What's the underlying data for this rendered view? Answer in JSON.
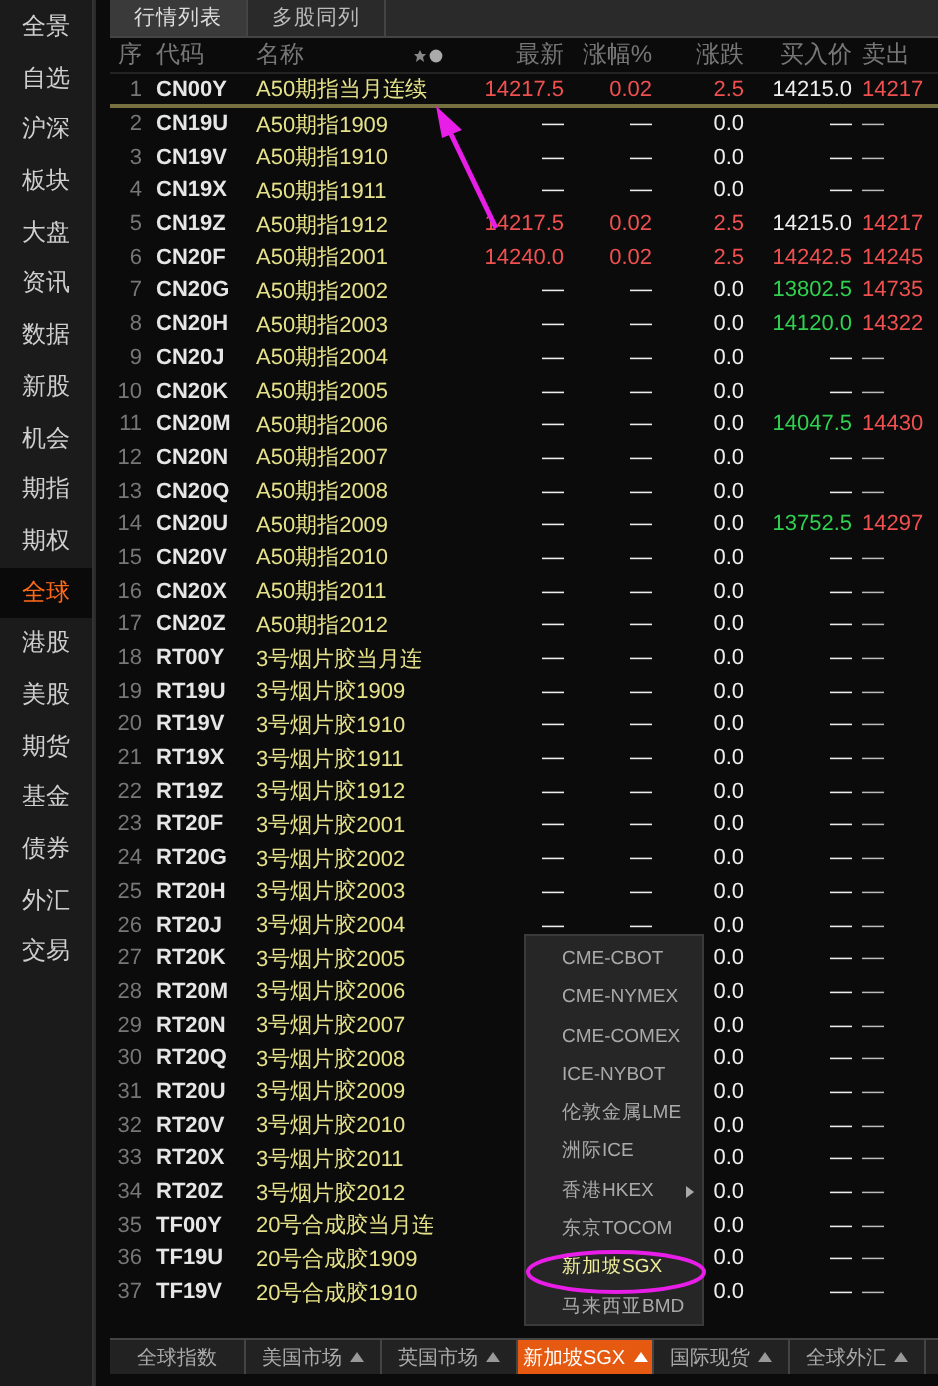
{
  "sidebar": {
    "items": [
      {
        "label": "全景",
        "selected": false
      },
      {
        "label": "自选",
        "selected": false
      },
      {
        "label": "沪深",
        "selected": false
      },
      {
        "label": "板块",
        "selected": false
      },
      {
        "label": "大盘",
        "selected": false
      },
      {
        "label": "资讯",
        "selected": false
      },
      {
        "label": "数据",
        "selected": false
      },
      {
        "label": "新股",
        "selected": false
      },
      {
        "label": "机会",
        "selected": false
      },
      {
        "label": "期指",
        "selected": false
      },
      {
        "label": "期权",
        "selected": false
      },
      {
        "label": "全球",
        "selected": true
      },
      {
        "label": "港股",
        "selected": false
      },
      {
        "label": "美股",
        "selected": false
      },
      {
        "label": "期货",
        "selected": false
      },
      {
        "label": "基金",
        "selected": false
      },
      {
        "label": "债券",
        "selected": false
      },
      {
        "label": "外汇",
        "selected": false
      },
      {
        "label": "交易",
        "selected": false
      }
    ]
  },
  "tabs": [
    {
      "label": "行情列表",
      "selected": true
    },
    {
      "label": "多股同列",
      "selected": false
    }
  ],
  "table": {
    "columns": [
      "序",
      "代码",
      "名称",
      "最新",
      "涨幅%",
      "涨跌",
      "买入价",
      "卖出"
    ],
    "rows": [
      {
        "no": "1",
        "code": "CN00Y",
        "name": "A50期指当月连续",
        "last": "14217.5",
        "pct": "0.02",
        "chg": "2.5",
        "color": "#f05050",
        "bid": {
          "value": "14215.0",
          "color": "#eeeeee"
        },
        "ask": "14217",
        "selected": true
      },
      {
        "no": "2",
        "code": "CN19U",
        "name": "A50期指1909",
        "last": "—",
        "pct": "—",
        "chg": "0.0",
        "color": "#eeeeee",
        "bid": {
          "value": "—",
          "color": "#eeeeee"
        },
        "ask": "—",
        "selected": false
      },
      {
        "no": "3",
        "code": "CN19V",
        "name": "A50期指1910",
        "last": "—",
        "pct": "—",
        "chg": "0.0",
        "color": "#eeeeee",
        "bid": {
          "value": "—",
          "color": "#eeeeee"
        },
        "ask": "—",
        "selected": false
      },
      {
        "no": "4",
        "code": "CN19X",
        "name": "A50期指1911",
        "last": "—",
        "pct": "—",
        "chg": "0.0",
        "color": "#eeeeee",
        "bid": {
          "value": "—",
          "color": "#eeeeee"
        },
        "ask": "—",
        "selected": false
      },
      {
        "no": "5",
        "code": "CN19Z",
        "name": "A50期指1912",
        "last": "14217.5",
        "pct": "0.02",
        "chg": "2.5",
        "color": "#f05050",
        "bid": {
          "value": "14215.0",
          "color": "#eeeeee"
        },
        "ask": "14217",
        "selected": false
      },
      {
        "no": "6",
        "code": "CN20F",
        "name": "A50期指2001",
        "last": "14240.0",
        "pct": "0.02",
        "chg": "2.5",
        "color": "#f05050",
        "bid": {
          "value": "14242.5",
          "color": "#f05050"
        },
        "ask": "14245",
        "selected": false
      },
      {
        "no": "7",
        "code": "CN20G",
        "name": "A50期指2002",
        "last": "—",
        "pct": "—",
        "chg": "0.0",
        "color": "#eeeeee",
        "bid": {
          "value": "13802.5",
          "color": "#30d050"
        },
        "ask": "14735",
        "selected": false
      },
      {
        "no": "8",
        "code": "CN20H",
        "name": "A50期指2003",
        "last": "—",
        "pct": "—",
        "chg": "0.0",
        "color": "#eeeeee",
        "bid": {
          "value": "14120.0",
          "color": "#30d050"
        },
        "ask": "14322",
        "selected": false
      },
      {
        "no": "9",
        "code": "CN20J",
        "name": "A50期指2004",
        "last": "—",
        "pct": "—",
        "chg": "0.0",
        "color": "#eeeeee",
        "bid": {
          "value": "—",
          "color": "#eeeeee"
        },
        "ask": "—",
        "selected": false
      },
      {
        "no": "10",
        "code": "CN20K",
        "name": "A50期指2005",
        "last": "—",
        "pct": "—",
        "chg": "0.0",
        "color": "#eeeeee",
        "bid": {
          "value": "—",
          "color": "#eeeeee"
        },
        "ask": "—",
        "selected": false
      },
      {
        "no": "11",
        "code": "CN20M",
        "name": "A50期指2006",
        "last": "—",
        "pct": "—",
        "chg": "0.0",
        "color": "#eeeeee",
        "bid": {
          "value": "14047.5",
          "color": "#30d050"
        },
        "ask": "14430",
        "selected": false
      },
      {
        "no": "12",
        "code": "CN20N",
        "name": "A50期指2007",
        "last": "—",
        "pct": "—",
        "chg": "0.0",
        "color": "#eeeeee",
        "bid": {
          "value": "—",
          "color": "#eeeeee"
        },
        "ask": "—",
        "selected": false
      },
      {
        "no": "13",
        "code": "CN20Q",
        "name": "A50期指2008",
        "last": "—",
        "pct": "—",
        "chg": "0.0",
        "color": "#eeeeee",
        "bid": {
          "value": "—",
          "color": "#eeeeee"
        },
        "ask": "—",
        "selected": false
      },
      {
        "no": "14",
        "code": "CN20U",
        "name": "A50期指2009",
        "last": "—",
        "pct": "—",
        "chg": "0.0",
        "color": "#eeeeee",
        "bid": {
          "value": "13752.5",
          "color": "#30d050"
        },
        "ask": "14297",
        "selected": false
      },
      {
        "no": "15",
        "code": "CN20V",
        "name": "A50期指2010",
        "last": "—",
        "pct": "—",
        "chg": "0.0",
        "color": "#eeeeee",
        "bid": {
          "value": "—",
          "color": "#eeeeee"
        },
        "ask": "—",
        "selected": false
      },
      {
        "no": "16",
        "code": "CN20X",
        "name": "A50期指2011",
        "last": "—",
        "pct": "—",
        "chg": "0.0",
        "color": "#eeeeee",
        "bid": {
          "value": "—",
          "color": "#eeeeee"
        },
        "ask": "—",
        "selected": false
      },
      {
        "no": "17",
        "code": "CN20Z",
        "name": "A50期指2012",
        "last": "—",
        "pct": "—",
        "chg": "0.0",
        "color": "#eeeeee",
        "bid": {
          "value": "—",
          "color": "#eeeeee"
        },
        "ask": "—",
        "selected": false
      },
      {
        "no": "18",
        "code": "RT00Y",
        "name": "3号烟片胶当月连",
        "last": "—",
        "pct": "—",
        "chg": "0.0",
        "color": "#eeeeee",
        "bid": {
          "value": "—",
          "color": "#eeeeee"
        },
        "ask": "—",
        "selected": false
      },
      {
        "no": "19",
        "code": "RT19U",
        "name": "3号烟片胶1909",
        "last": "—",
        "pct": "—",
        "chg": "0.0",
        "color": "#eeeeee",
        "bid": {
          "value": "—",
          "color": "#eeeeee"
        },
        "ask": "—",
        "selected": false
      },
      {
        "no": "20",
        "code": "RT19V",
        "name": "3号烟片胶1910",
        "last": "—",
        "pct": "—",
        "chg": "0.0",
        "color": "#eeeeee",
        "bid": {
          "value": "—",
          "color": "#eeeeee"
        },
        "ask": "—",
        "selected": false
      },
      {
        "no": "21",
        "code": "RT19X",
        "name": "3号烟片胶1911",
        "last": "—",
        "pct": "—",
        "chg": "0.0",
        "color": "#eeeeee",
        "bid": {
          "value": "—",
          "color": "#eeeeee"
        },
        "ask": "—",
        "selected": false
      },
      {
        "no": "22",
        "code": "RT19Z",
        "name": "3号烟片胶1912",
        "last": "—",
        "pct": "—",
        "chg": "0.0",
        "color": "#eeeeee",
        "bid": {
          "value": "—",
          "color": "#eeeeee"
        },
        "ask": "—",
        "selected": false
      },
      {
        "no": "23",
        "code": "RT20F",
        "name": "3号烟片胶2001",
        "last": "—",
        "pct": "—",
        "chg": "0.0",
        "color": "#eeeeee",
        "bid": {
          "value": "—",
          "color": "#eeeeee"
        },
        "ask": "—",
        "selected": false
      },
      {
        "no": "24",
        "code": "RT20G",
        "name": "3号烟片胶2002",
        "last": "—",
        "pct": "—",
        "chg": "0.0",
        "color": "#eeeeee",
        "bid": {
          "value": "—",
          "color": "#eeeeee"
        },
        "ask": "—",
        "selected": false
      },
      {
        "no": "25",
        "code": "RT20H",
        "name": "3号烟片胶2003",
        "last": "—",
        "pct": "—",
        "chg": "0.0",
        "color": "#eeeeee",
        "bid": {
          "value": "—",
          "color": "#eeeeee"
        },
        "ask": "—",
        "selected": false
      },
      {
        "no": "26",
        "code": "RT20J",
        "name": "3号烟片胶2004",
        "last": "—",
        "pct": "—",
        "chg": "0.0",
        "color": "#eeeeee",
        "bid": {
          "value": "—",
          "color": "#eeeeee"
        },
        "ask": "—",
        "selected": false
      },
      {
        "no": "27",
        "code": "RT20K",
        "name": "3号烟片胶2005",
        "chg": "0.0",
        "color": "#eeeeee",
        "bid": {
          "value": "—",
          "color": "#eeeeee"
        },
        "ask": "—",
        "selected": false
      },
      {
        "no": "28",
        "code": "RT20M",
        "name": "3号烟片胶2006",
        "chg": "0.0",
        "color": "#eeeeee",
        "bid": {
          "value": "—",
          "color": "#eeeeee"
        },
        "ask": "—",
        "selected": false
      },
      {
        "no": "29",
        "code": "RT20N",
        "name": "3号烟片胶2007",
        "chg": "0.0",
        "color": "#eeeeee",
        "bid": {
          "value": "—",
          "color": "#eeeeee"
        },
        "ask": "—",
        "selected": false
      },
      {
        "no": "30",
        "code": "RT20Q",
        "name": "3号烟片胶2008",
        "chg": "0.0",
        "color": "#eeeeee",
        "bid": {
          "value": "—",
          "color": "#eeeeee"
        },
        "ask": "—",
        "selected": false
      },
      {
        "no": "31",
        "code": "RT20U",
        "name": "3号烟片胶2009",
        "chg": "0.0",
        "color": "#eeeeee",
        "bid": {
          "value": "—",
          "color": "#eeeeee"
        },
        "ask": "—",
        "selected": false
      },
      {
        "no": "32",
        "code": "RT20V",
        "name": "3号烟片胶2010",
        "chg": "0.0",
        "color": "#eeeeee",
        "bid": {
          "value": "—",
          "color": "#eeeeee"
        },
        "ask": "—",
        "selected": false
      },
      {
        "no": "33",
        "code": "RT20X",
        "name": "3号烟片胶2011",
        "chg": "0.0",
        "color": "#eeeeee",
        "bid": {
          "value": "—",
          "color": "#eeeeee"
        },
        "ask": "—",
        "selected": false
      },
      {
        "no": "34",
        "code": "RT20Z",
        "name": "3号烟片胶2012",
        "chg": "0.0",
        "color": "#eeeeee",
        "bid": {
          "value": "—",
          "color": "#eeeeee"
        },
        "ask": "—",
        "selected": false
      },
      {
        "no": "35",
        "code": "TF00Y",
        "name": "20号合成胶当月连",
        "chg": "0.0",
        "color": "#eeeeee",
        "bid": {
          "value": "—",
          "color": "#eeeeee"
        },
        "ask": "—",
        "selected": false
      },
      {
        "no": "36",
        "code": "TF19U",
        "name": "20号合成胶1909",
        "chg": "0.0",
        "color": "#eeeeee",
        "bid": {
          "value": "—",
          "color": "#eeeeee"
        },
        "ask": "—",
        "selected": false
      },
      {
        "no": "37",
        "code": "TF19V",
        "name": "20号合成胶1910",
        "chg": "0.0",
        "color": "#eeeeee",
        "bid": {
          "value": "—",
          "color": "#eeeeee"
        },
        "ask": "—",
        "selected": false
      }
    ]
  },
  "dropdown": {
    "items": [
      {
        "label": "CME-CBOT",
        "selected": false,
        "submenu": false
      },
      {
        "label": "CME-NYMEX",
        "selected": false,
        "submenu": false
      },
      {
        "label": "CME-COMEX",
        "selected": false,
        "submenu": false
      },
      {
        "label": "ICE-NYBOT",
        "selected": false,
        "submenu": false
      },
      {
        "label": "伦敦金属LME",
        "selected": false,
        "submenu": false
      },
      {
        "label": "洲际ICE",
        "selected": false,
        "submenu": false
      },
      {
        "label": "香港HKEX",
        "selected": false,
        "submenu": true
      },
      {
        "label": "东京TOCOM",
        "selected": false,
        "submenu": false
      },
      {
        "label": "新加坡SGX",
        "selected": true,
        "submenu": false
      },
      {
        "label": "马来西亚BMD",
        "selected": false,
        "submenu": false
      }
    ]
  },
  "bottom_tabs": [
    {
      "label": "全球指数",
      "selected": false,
      "caret": false
    },
    {
      "label": "美国市场",
      "selected": false,
      "caret": true
    },
    {
      "label": "英国市场",
      "selected": false,
      "caret": true
    },
    {
      "label": "新加坡SGX",
      "selected": true,
      "caret": true
    },
    {
      "label": "国际现货",
      "selected": false,
      "caret": true
    },
    {
      "label": "全球外汇",
      "selected": false,
      "caret": true
    }
  ]
}
